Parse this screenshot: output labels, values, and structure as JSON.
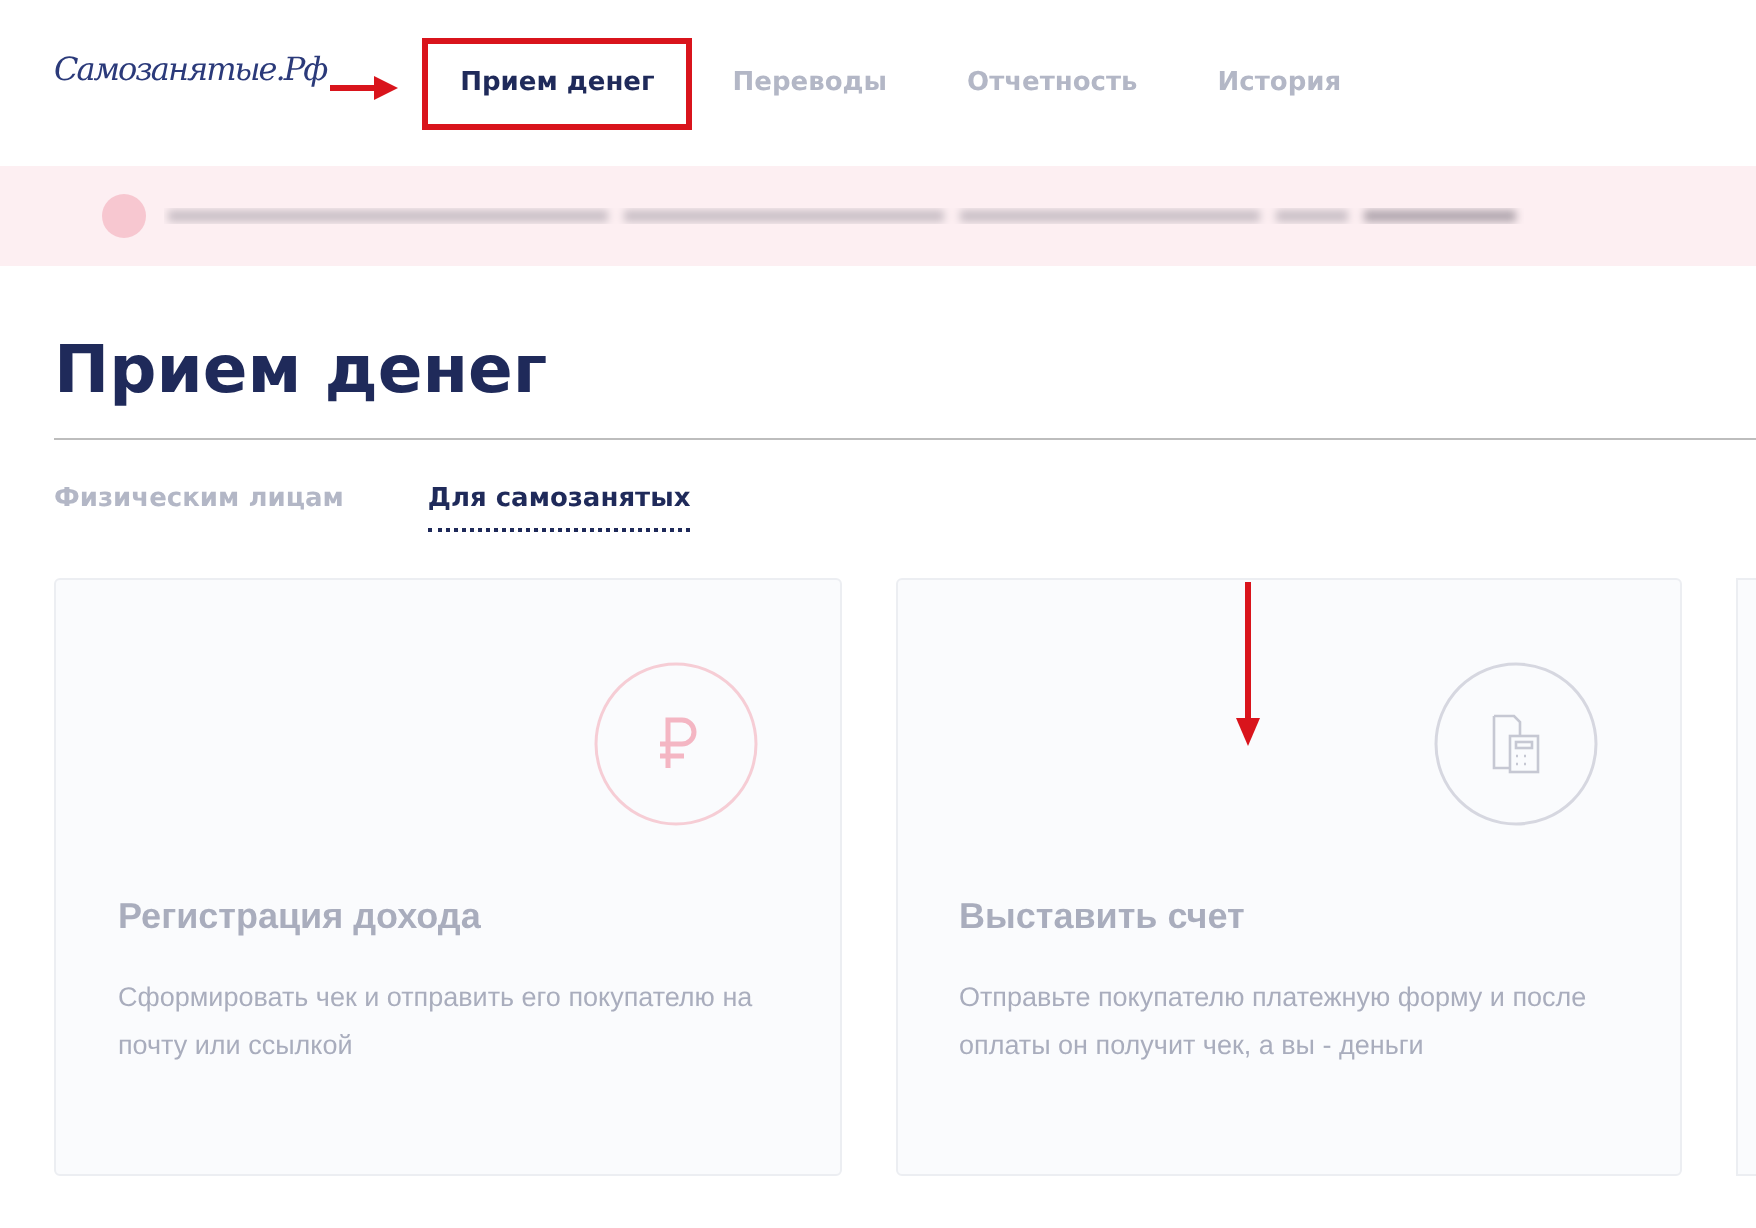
{
  "logo": {
    "text": "Самозанятые.Рф"
  },
  "nav": [
    {
      "label": "Прием денег",
      "selected": true
    },
    {
      "label": "Переводы",
      "selected": false
    },
    {
      "label": "Отчетность",
      "selected": false
    },
    {
      "label": "История",
      "selected": false
    }
  ],
  "page_title": "Прием денег",
  "tabs": [
    {
      "label": "Физическим лицам",
      "selected": false
    },
    {
      "label": "Для самозанятых",
      "selected": true
    }
  ],
  "cards": [
    {
      "kind": "ruble",
      "title": "Регистрация дохода",
      "text": "Сформировать чек и отправить его покупателю на почту или ссылкой"
    },
    {
      "kind": "invoice",
      "title": "Выставить счет",
      "text": "Отправьте покупателю платежную форму и после оплаты он получит чек, а вы - деньги"
    }
  ]
}
